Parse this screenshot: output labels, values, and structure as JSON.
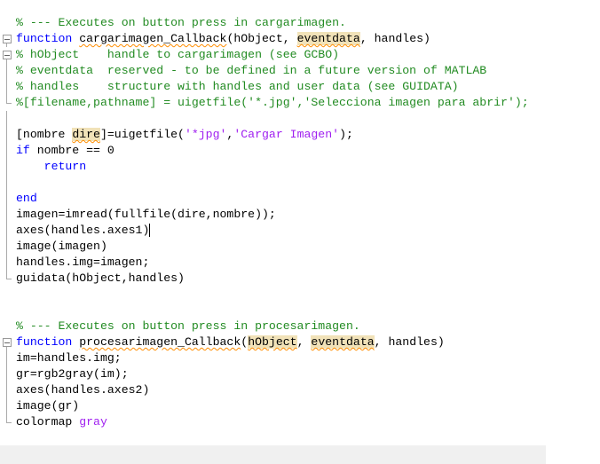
{
  "editor": {
    "lines": [
      {
        "fold": "none",
        "segs": [
          {
            "t": "% --- Executes on button press in cargarimagen.",
            "c": "cm"
          }
        ]
      },
      {
        "fold": "start",
        "segs": [
          {
            "t": "function ",
            "c": "kw"
          },
          {
            "t": "cargarimagen_Callback",
            "c": "sq"
          },
          {
            "t": "(hObject, ",
            "c": ""
          },
          {
            "t": "eventdata",
            "c": "hl sq"
          },
          {
            "t": ", handles)",
            "c": ""
          }
        ]
      },
      {
        "fold": "start",
        "segs": [
          {
            "t": "% hObject    handle to cargarimagen (see GCBO)",
            "c": "cm"
          }
        ]
      },
      {
        "fold": "line",
        "segs": [
          {
            "t": "% eventdata  reserved - to be defined in a future version of MATLAB",
            "c": "cm"
          }
        ]
      },
      {
        "fold": "line",
        "segs": [
          {
            "t": "% handles    structure with handles and user data (see GUIDATA)",
            "c": "cm"
          }
        ]
      },
      {
        "fold": "end",
        "segs": [
          {
            "t": "%[filename,pathname] = uigetfile('*.jpg','Selecciona imagen para abrir');",
            "c": "cm"
          }
        ]
      },
      {
        "fold": "line",
        "segs": []
      },
      {
        "fold": "line",
        "segs": [
          {
            "t": "[nombre ",
            "c": ""
          },
          {
            "t": "dire",
            "c": "hl sq"
          },
          {
            "t": "]=uigetfile(",
            "c": ""
          },
          {
            "t": "'*jpg'",
            "c": "str"
          },
          {
            "t": ",",
            "c": ""
          },
          {
            "t": "'Cargar Imagen'",
            "c": "str"
          },
          {
            "t": ");",
            "c": ""
          }
        ]
      },
      {
        "fold": "line",
        "segs": [
          {
            "t": "if",
            "c": "kw"
          },
          {
            "t": " nombre == 0",
            "c": ""
          }
        ]
      },
      {
        "fold": "line",
        "segs": [
          {
            "t": "    ",
            "c": ""
          },
          {
            "t": "return",
            "c": "kw"
          }
        ]
      },
      {
        "fold": "line",
        "segs": []
      },
      {
        "fold": "line",
        "segs": [
          {
            "t": "end",
            "c": "kw"
          }
        ]
      },
      {
        "fold": "line",
        "segs": [
          {
            "t": "imagen=imread(fullfile(dire,nombre));",
            "c": ""
          }
        ]
      },
      {
        "fold": "line",
        "segs": [
          {
            "t": "axes(handles.axes1)",
            "c": ""
          }
        ],
        "caret": true
      },
      {
        "fold": "line",
        "segs": [
          {
            "t": "image(imagen)",
            "c": ""
          }
        ]
      },
      {
        "fold": "line",
        "segs": [
          {
            "t": "handles.img=imagen;",
            "c": ""
          }
        ]
      },
      {
        "fold": "end",
        "segs": [
          {
            "t": "guidata(hObject,handles)",
            "c": ""
          }
        ]
      },
      {
        "fold": "none",
        "segs": []
      },
      {
        "fold": "none",
        "segs": []
      },
      {
        "fold": "none",
        "segs": [
          {
            "t": "% --- Executes on button press in procesarimagen.",
            "c": "cm"
          }
        ]
      },
      {
        "fold": "start",
        "segs": [
          {
            "t": "function ",
            "c": "kw"
          },
          {
            "t": "procesarimagen_Callback",
            "c": "sq"
          },
          {
            "t": "(",
            "c": ""
          },
          {
            "t": "hObject",
            "c": "hl sq"
          },
          {
            "t": ", ",
            "c": ""
          },
          {
            "t": "eventdata",
            "c": "hl sq"
          },
          {
            "t": ", handles)",
            "c": ""
          }
        ]
      },
      {
        "fold": "line",
        "segs": [
          {
            "t": "im=handles.img;",
            "c": ""
          }
        ]
      },
      {
        "fold": "line",
        "segs": [
          {
            "t": "gr=rgb2gray(im);",
            "c": ""
          }
        ]
      },
      {
        "fold": "line",
        "segs": [
          {
            "t": "axes(handles.axes2)",
            "c": ""
          }
        ]
      },
      {
        "fold": "line",
        "segs": [
          {
            "t": "image(gr)",
            "c": ""
          }
        ]
      },
      {
        "fold": "end",
        "segs": [
          {
            "t": "colormap ",
            "c": ""
          },
          {
            "t": "gray",
            "c": "str"
          }
        ]
      }
    ]
  },
  "colors": {
    "keyword": "#0000ff",
    "comment": "#228b22",
    "string": "#a020f0",
    "highlight": "#f1e2b8"
  }
}
